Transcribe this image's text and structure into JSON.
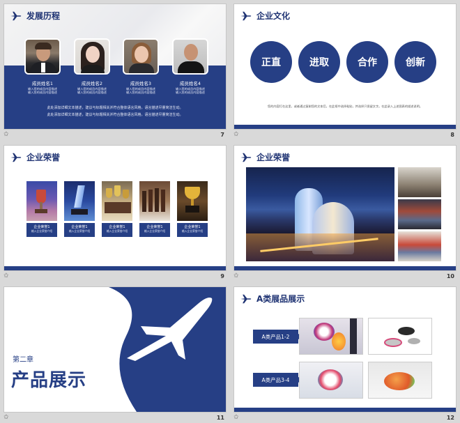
{
  "slides": [
    {
      "number": "7",
      "title": "发展历程",
      "members": [
        {
          "name": "成员姓名1",
          "desc1": "输入您的成员内容描述",
          "desc2": "输入您的成员内容描述"
        },
        {
          "name": "成员姓名2",
          "desc1": "输入您的成员内容描述",
          "desc2": "输入您的成员内容描述"
        },
        {
          "name": "成员姓名3",
          "desc1": "输入您的成员内容描述",
          "desc2": "输入您的成员内容描述"
        },
        {
          "name": "成员姓名4",
          "desc1": "输入您的成员内容描述",
          "desc2": "输入您的成员内容描述"
        }
      ],
      "paragraph": [
        "此处添加详细文本描述，建议与标题相关并符合整体语言风格，语言描述尽量简洁生动。",
        "此处添加详细文本描述，建议与标题相关并符合整体语言风格，语言描述尽量简洁生动。"
      ]
    },
    {
      "number": "8",
      "title": "企业文化",
      "values": [
        "正直",
        "进取",
        "合作",
        "创新"
      ],
      "line": "您的内容打在这里，或者通过复制您的文本后，在此框中选择粘贴，并选择只保留文字。在此录入上述图表的描述说明。"
    },
    {
      "number": "9",
      "title": "企业荣誉",
      "cards": [
        {
          "a": "企业荣誉1",
          "b": "输入企业荣誉介绍"
        },
        {
          "a": "企业荣誉1",
          "b": "输入企业荣誉介绍"
        },
        {
          "a": "企业荣誉1",
          "b": "输入企业荣誉介绍"
        },
        {
          "a": "企业荣誉1",
          "b": "输入企业荣誉介绍"
        },
        {
          "a": "企业荣誉1",
          "b": "输入企业荣誉介绍"
        }
      ]
    },
    {
      "number": "10",
      "title": "企业荣誉"
    },
    {
      "number": "11",
      "chapter": "第二章",
      "title": "产品展示"
    },
    {
      "number": "12",
      "title": "A类展品展示",
      "tags": [
        "A类产品1-2",
        "A类产品3-4"
      ]
    }
  ],
  "icons": {
    "slide_marker": "star-icon",
    "header": "airplane-icon"
  },
  "colors": {
    "brand_navy": "#263f85",
    "background": "#d9d9d9"
  }
}
